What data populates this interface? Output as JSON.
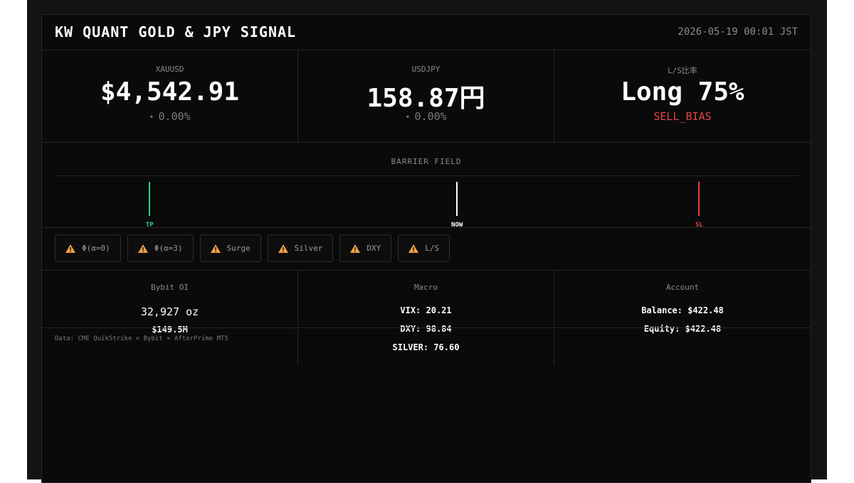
{
  "header": {
    "title": "KW QUANT GOLD & JPY SIGNAL",
    "timestamp": "2026-05-19 00:01 JST"
  },
  "stats": [
    {
      "label": "XAUUSD",
      "value": "$4,542.91",
      "dot": "•",
      "sub": "0.00%"
    },
    {
      "label": "USDJPY",
      "value": "158.87円",
      "dot": "•",
      "sub": "0.00%"
    },
    {
      "label": "L/S比率",
      "value": "Long 75%",
      "sub": "SELL_BIAS"
    }
  ],
  "barrier": {
    "title": "BARRIER FIELD",
    "markers": [
      {
        "label": "TP",
        "position": 0.14,
        "color": "#2fd17a"
      },
      {
        "label": "NOW",
        "position": 0.54,
        "color": "#ffffff"
      },
      {
        "label": "SL",
        "position": 0.855,
        "color": "#e54444"
      }
    ]
  },
  "badges": [
    {
      "label": "Φ(α=0)",
      "icon": "warning-icon"
    },
    {
      "label": "Φ(α=3)",
      "icon": "warning-icon"
    },
    {
      "label": "Surge",
      "icon": "warning-icon"
    },
    {
      "label": "Silver",
      "icon": "warning-icon"
    },
    {
      "label": "DXY",
      "icon": "warning-icon"
    },
    {
      "label": "L/S",
      "icon": "warning-icon"
    }
  ],
  "oi": {
    "title": "Bybit OI",
    "amount": "32,927 oz",
    "value": "$149.5M"
  },
  "macro": {
    "title": "Macro",
    "lines": [
      "VIX: 20.21",
      "DXY: 98.84",
      "SILVER: 76.60"
    ]
  },
  "account": {
    "title": "Account",
    "lines": [
      "Balance: $422.48",
      "Equity: $422.48"
    ]
  },
  "footnote": "Data: CME QuikStrike × Bybit × AfterPrime MT5",
  "colors": {
    "warning": "#f0a045",
    "sell": "#e54444",
    "tp": "#2fd17a",
    "sl": "#e54444"
  }
}
